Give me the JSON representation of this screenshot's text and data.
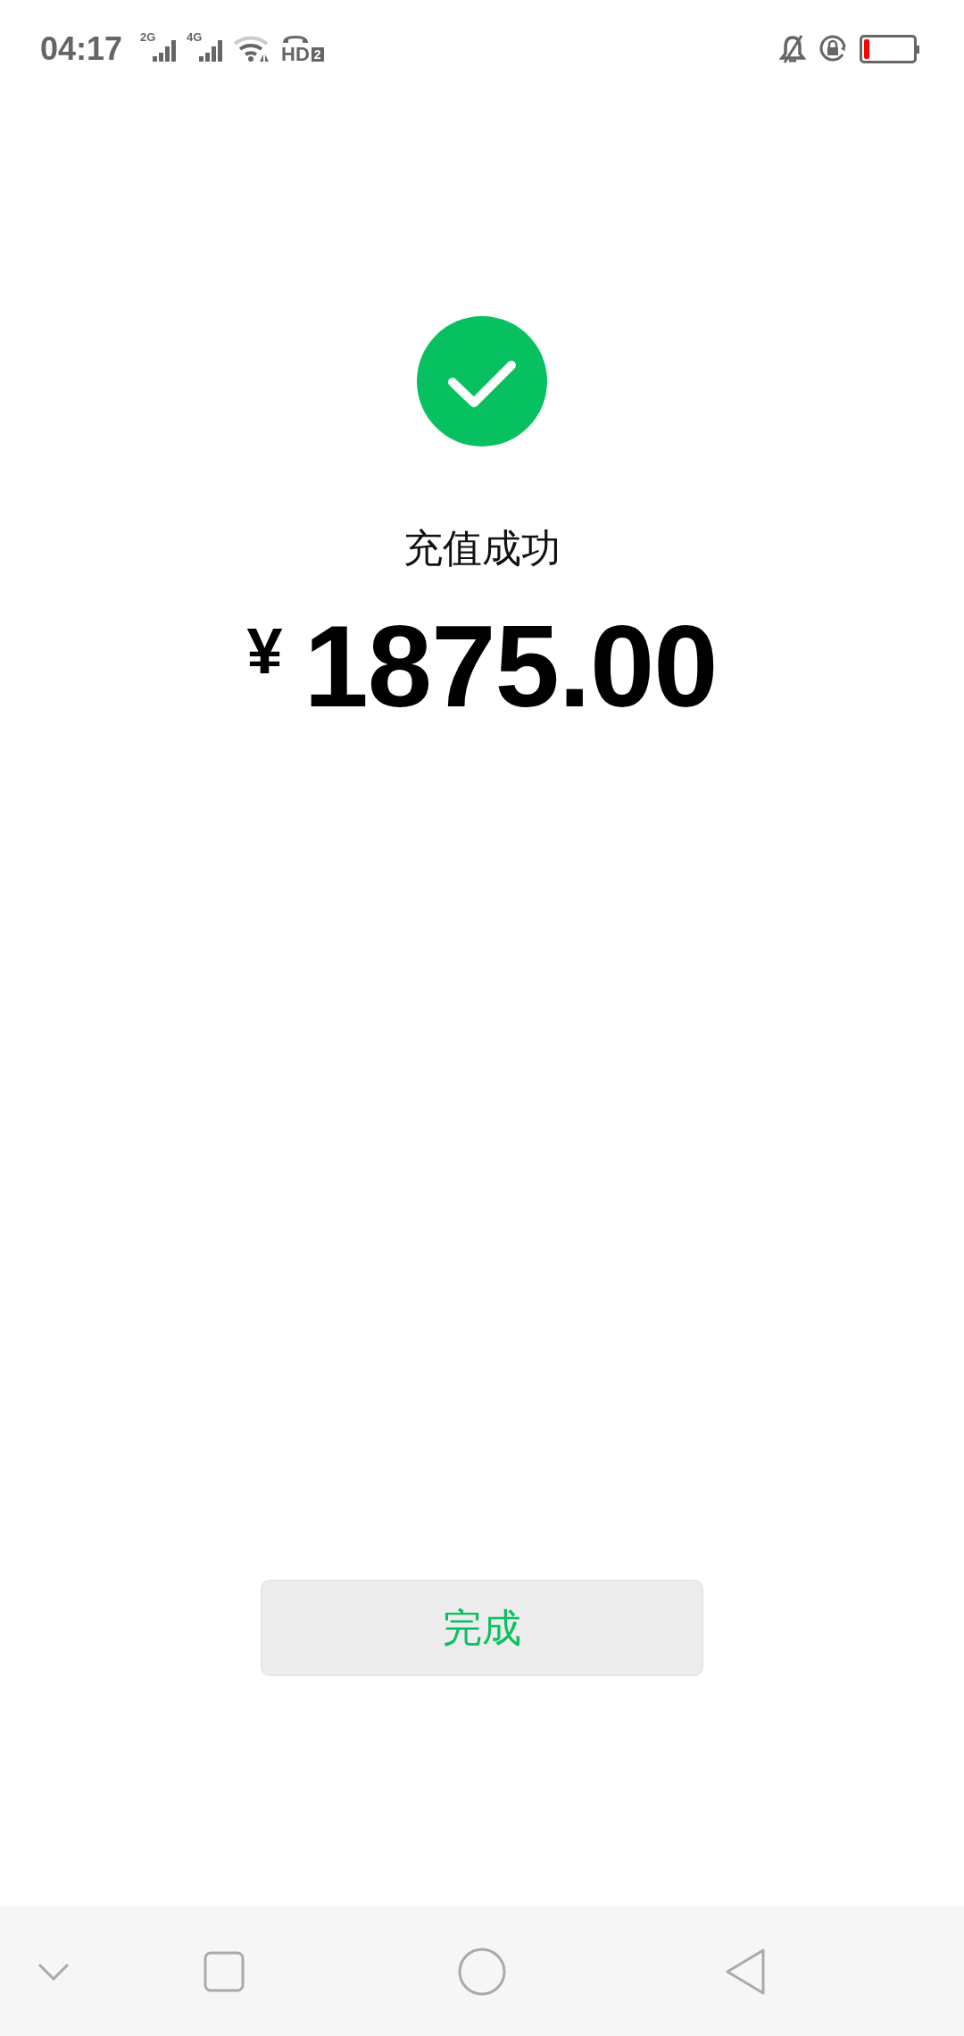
{
  "status_bar": {
    "time": "04:17",
    "sim_1": "2G",
    "sim_2": "4G",
    "hd": "HD",
    "hd_index": "2"
  },
  "result": {
    "title": "充值成功",
    "currency": "¥",
    "amount": "1875.00"
  },
  "done_button": {
    "label": "完成"
  }
}
